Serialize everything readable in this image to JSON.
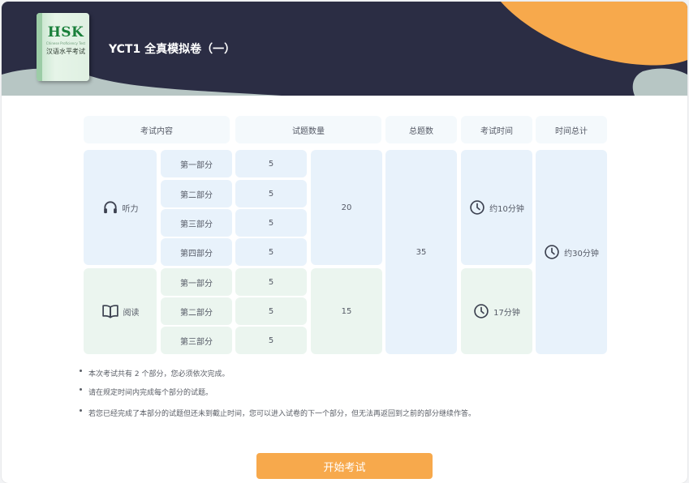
{
  "header": {
    "logo_text": "HSK",
    "logo_subtitle": "Chinese Proficiency Test",
    "logo_caption": "汉语水平考试",
    "title": "YCT1 全真模拟卷（一）"
  },
  "table": {
    "headers": [
      "考试内容",
      "试题数量",
      "总题数",
      "考试时间",
      "时间总计"
    ],
    "sections": [
      {
        "name": "听力",
        "icon": "headphones-icon",
        "parts": [
          {
            "part": "第一部分",
            "count": "5"
          },
          {
            "part": "第二部分",
            "count": "5"
          },
          {
            "part": "第三部分",
            "count": "5"
          },
          {
            "part": "第四部分",
            "count": "5"
          }
        ],
        "subtotal": "20",
        "time": "约10分钟"
      },
      {
        "name": "阅读",
        "icon": "book-icon",
        "parts": [
          {
            "part": "第一部分",
            "count": "5"
          },
          {
            "part": "第二部分",
            "count": "5"
          },
          {
            "part": "第三部分",
            "count": "5"
          }
        ],
        "subtotal": "15",
        "time": "17分钟"
      }
    ],
    "total": "35",
    "total_time": "约30分钟"
  },
  "notes": [
    "本次考试共有 2 个部分，您必须依次完成。",
    "请在规定时间内完成每个部分的试题。",
    "若您已经完成了本部分的试题但还未到截止时间，您可以进入试卷的下一个部分，但无法再返回到之前的部分继续作答。"
  ],
  "start_button": "开始考试",
  "colors": {
    "header_bg": "#2b2d44",
    "accent_orange": "#f7a94c",
    "listening_bg": "#e8f2fb",
    "reading_bg": "#ebf5ef",
    "header_cell_bg": "#f4f9fc"
  }
}
